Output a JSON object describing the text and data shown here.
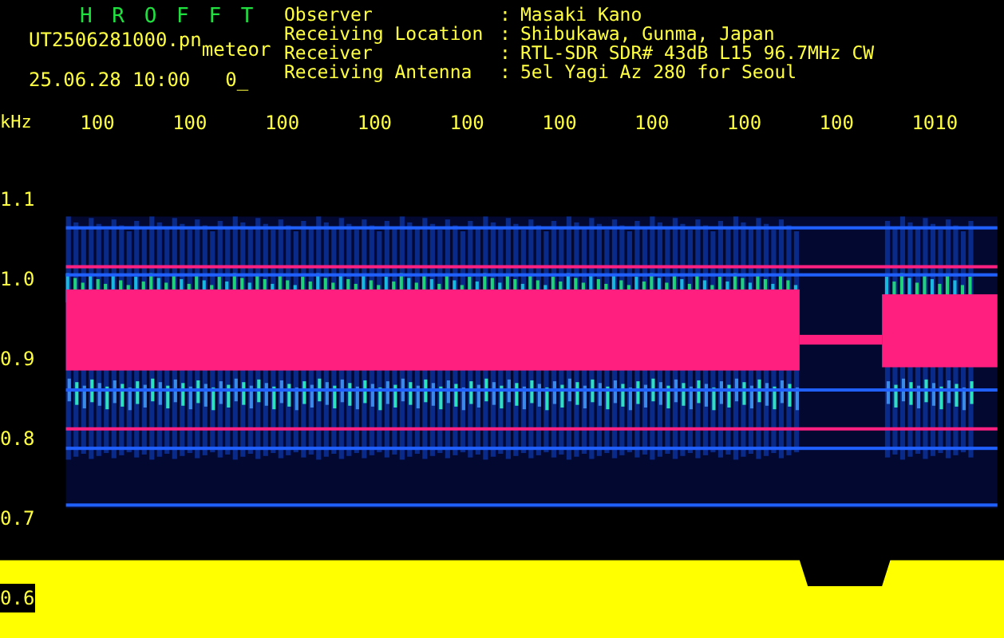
{
  "header": {
    "app_title": "HROFFT",
    "file_name": "UT2506281000.pn",
    "mode": "meteor",
    "timestamp": "25.06.28 10:00",
    "count": "0_"
  },
  "info": [
    {
      "label": "Observer",
      "separator": ":",
      "value": "Masaki Kano"
    },
    {
      "label": "Receiving Location",
      "separator": ":",
      "value": "Shibukawa, Gunma, Japan"
    },
    {
      "label": "Receiver",
      "separator": ":",
      "value": "RTL-SDR SDR# 43dB L15 96.7MHz CW"
    },
    {
      "label": "Receiving Antenna",
      "separator": ":",
      "value": "5el Yagi Az 280 for Seoul"
    }
  ],
  "axis": {
    "unit": "kHz",
    "time_labels": [
      "100",
      "100",
      "100",
      "100",
      "100",
      "100",
      "100",
      "100",
      "100",
      "1010"
    ],
    "freq_labels": [
      "1.1",
      "1.0",
      "0.9",
      "0.8",
      "0.7",
      "0.6"
    ]
  }
}
